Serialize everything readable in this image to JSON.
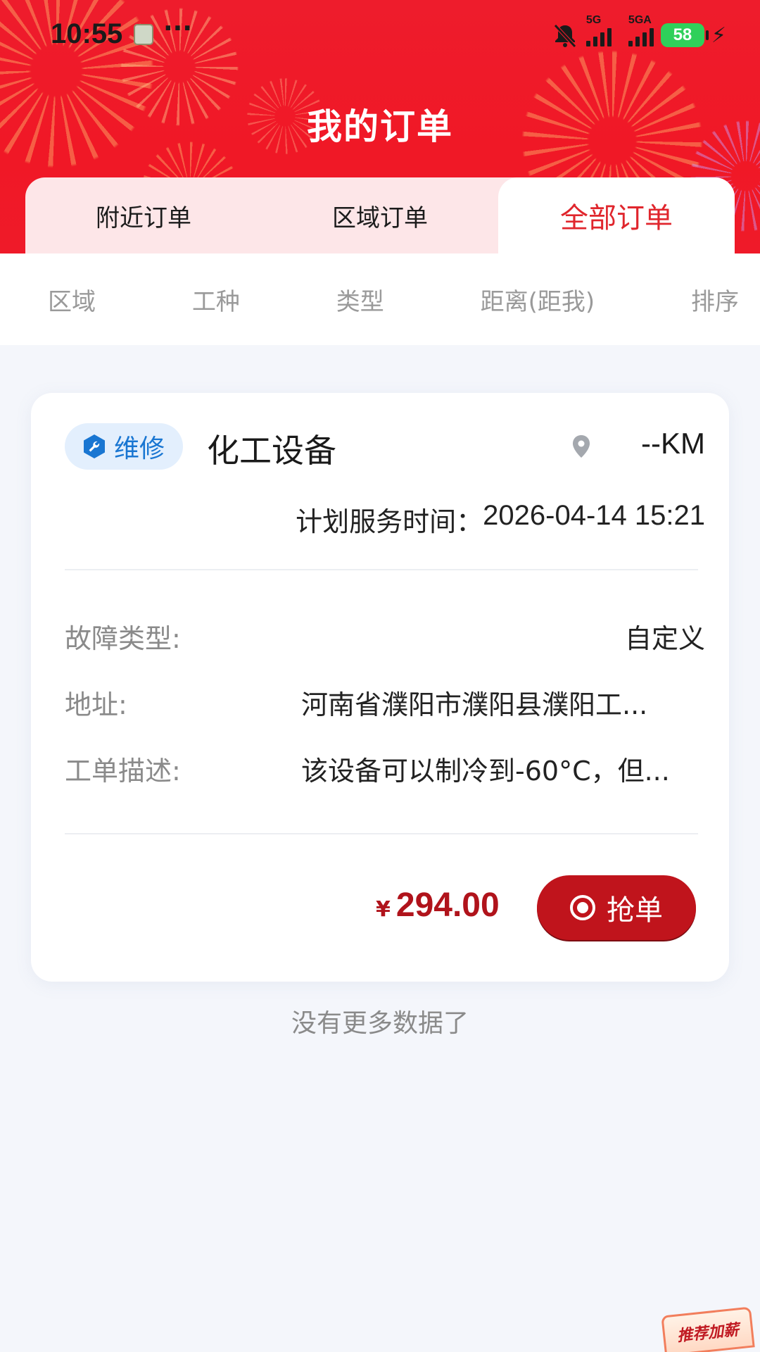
{
  "status_bar": {
    "time": "10:55",
    "dots": "···",
    "signal1_label": "5G",
    "signal2_label": "5GA",
    "battery": "58"
  },
  "header": {
    "title": "我的订单"
  },
  "tabs": [
    {
      "label": "附近订单",
      "active": false
    },
    {
      "label": "区域订单",
      "active": false
    },
    {
      "label": "全部订单",
      "active": true
    }
  ],
  "filters": [
    {
      "label": "区域"
    },
    {
      "label": "工种"
    },
    {
      "label": "类型"
    },
    {
      "label": "距离(距我)"
    },
    {
      "label": "排序"
    }
  ],
  "order": {
    "tag": "维修",
    "title": "化工设备",
    "distance": "--KM",
    "schedule_label": "计划服务时间：",
    "schedule_value": "2026-04-14 15:21",
    "fields": [
      {
        "label": "故障类型:",
        "value": "自定义"
      },
      {
        "label": "地址:",
        "value": "河南省濮阳市濮阳县濮阳工..."
      },
      {
        "label": "工单描述:",
        "value": "该设备可以制冷到-60°C，但..."
      }
    ],
    "currency": "¥",
    "price": "294.00",
    "action_label": "抢单"
  },
  "footer": {
    "no_more": "没有更多数据了"
  },
  "promo": {
    "label": "推荐加薪"
  },
  "colors": {
    "header_red": "#ee1c2c",
    "active_tab": "#e0262d",
    "price": "#b0131b",
    "button": "#c0141c",
    "tag_bg": "#e3effd",
    "tag_text": "#1976d2"
  }
}
